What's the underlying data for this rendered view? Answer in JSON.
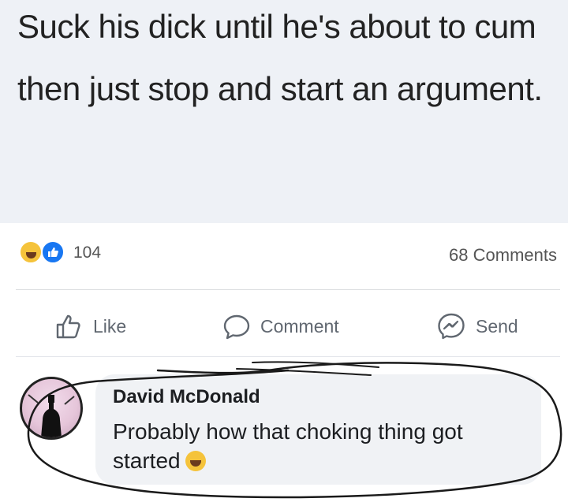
{
  "post": {
    "text": "Suck his dick until he's about to cum then just stop and start an argument."
  },
  "reactions": {
    "icons": [
      "haha-reaction-icon",
      "like-reaction-icon"
    ],
    "count": "104",
    "comments_count": "68 Comments"
  },
  "actions": {
    "like_label": "Like",
    "comment_label": "Comment",
    "send_label": "Send"
  },
  "comment": {
    "author": "David McDonald",
    "text": "Probably how that choking thing got started",
    "emoji": "laughing-emoji"
  },
  "colors": {
    "post_background": "#eef1f6",
    "like_blue": "#1877f2",
    "haha_yellow": "#f5c33b",
    "bubble_background": "#f0f2f5",
    "annotation_ink": "#1a1a1a"
  }
}
